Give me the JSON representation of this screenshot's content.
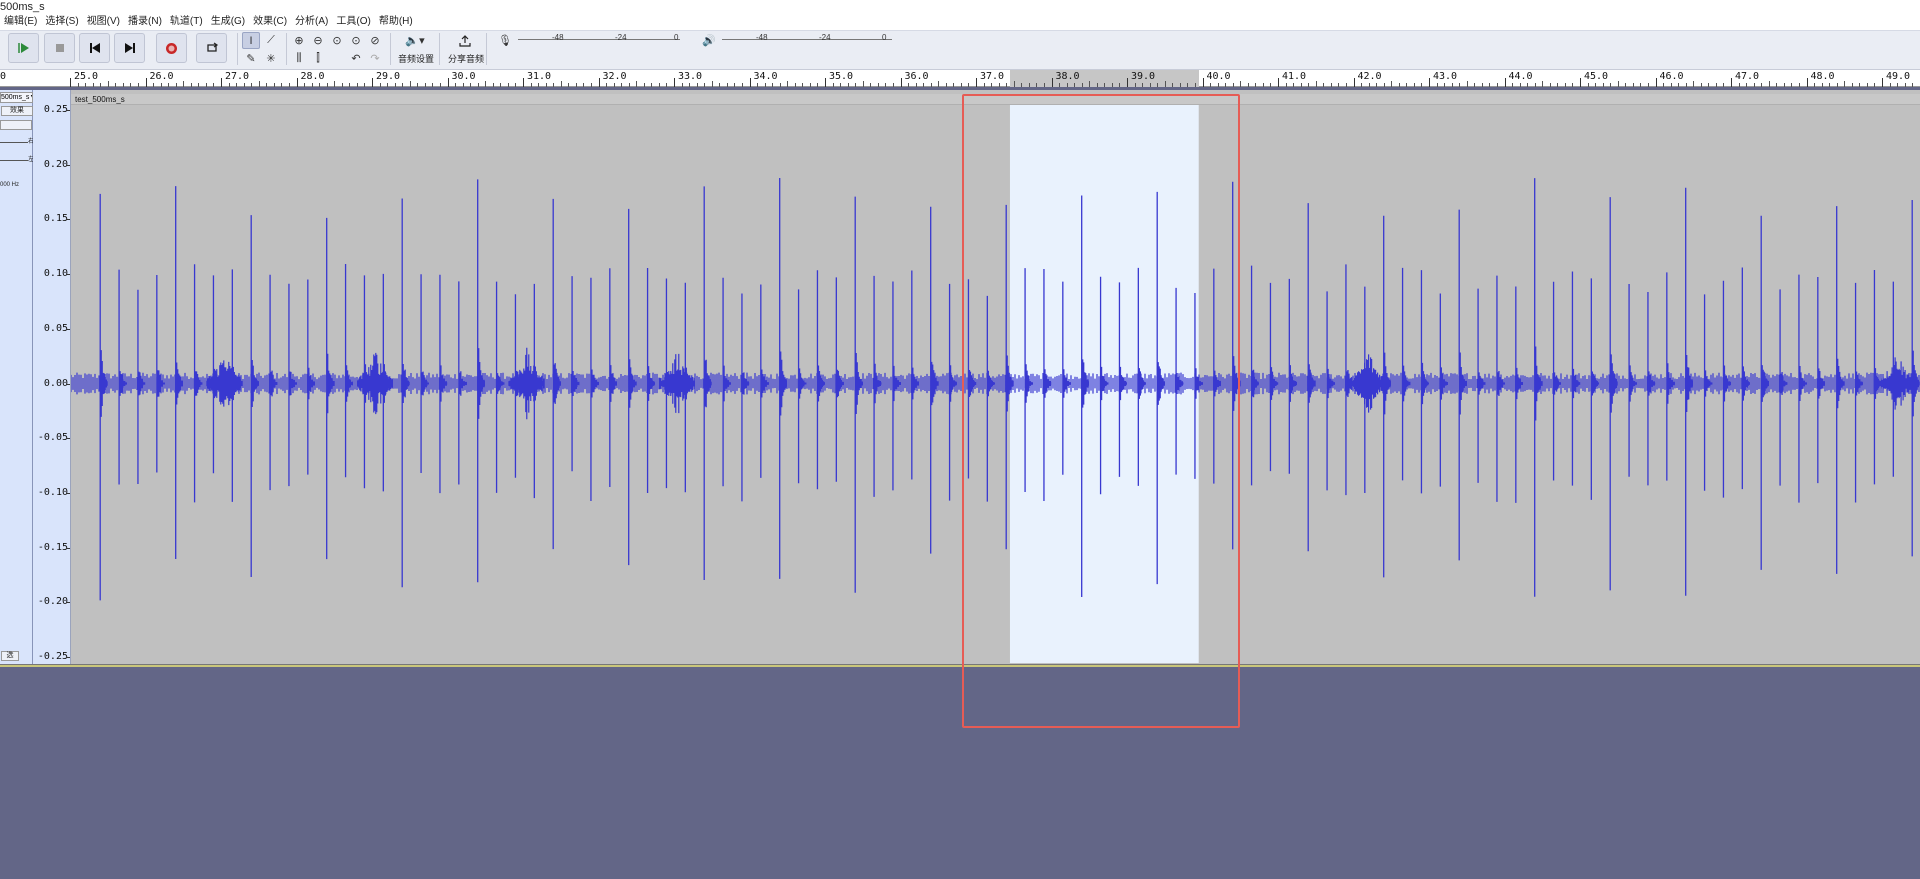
{
  "window": {
    "title": "500ms_s"
  },
  "menu": [
    "编辑(E)",
    "选择(S)",
    "视图(V)",
    "播录(N)",
    "轨道(T)",
    "生成(G)",
    "效果(C)",
    "分析(A)",
    "工具(O)",
    "帮助(H)"
  ],
  "toolbar": {
    "play_icon": "play-icon",
    "stop_icon": "stop-icon",
    "skip_start_icon": "skip-start-icon",
    "skip_end_icon": "skip-end-icon",
    "record_icon": "record-icon",
    "loop_icon": "loop-icon",
    "audio_setup_label": "音频设置",
    "share_audio_label": "分享音频",
    "meter_ticks": [
      "-48",
      "-24",
      "0"
    ]
  },
  "ruler": {
    "ticks": [
      "0",
      "25.0",
      "26.0",
      "27.0",
      "28.0",
      "29.0",
      "30.0",
      "31.0",
      "32.0",
      "33.0",
      "34.0",
      "35.0",
      "36.0",
      "37.0",
      "38.0",
      "39.0",
      "40.0",
      "41.0",
      "42.0",
      "43.0",
      "44.0",
      "45.0",
      "46.0",
      "47.0",
      "48.0",
      "49.0"
    ],
    "selection_start": 37.45,
    "selection_end": 39.95
  },
  "track": {
    "name_short": "500ms_s▼",
    "clip_name": "test_500ms_s",
    "button_label": "效果",
    "rate_label": "000 Hz",
    "pan_label": "左",
    "gain_label": "右",
    "bottom_label": "选"
  },
  "vertical_scale": [
    "0.25",
    "0.20",
    "0.15",
    "0.10",
    "0.05",
    "0.00",
    "-0.05",
    "-0.10",
    "-0.15",
    "-0.20",
    "-0.25"
  ],
  "colors": {
    "waveform": "#3838d0",
    "selection_bg": "#e9f2fd",
    "track_bg": "#c0c0c0",
    "empty_bg": "#636687",
    "highlight_box": "#e65c55"
  }
}
